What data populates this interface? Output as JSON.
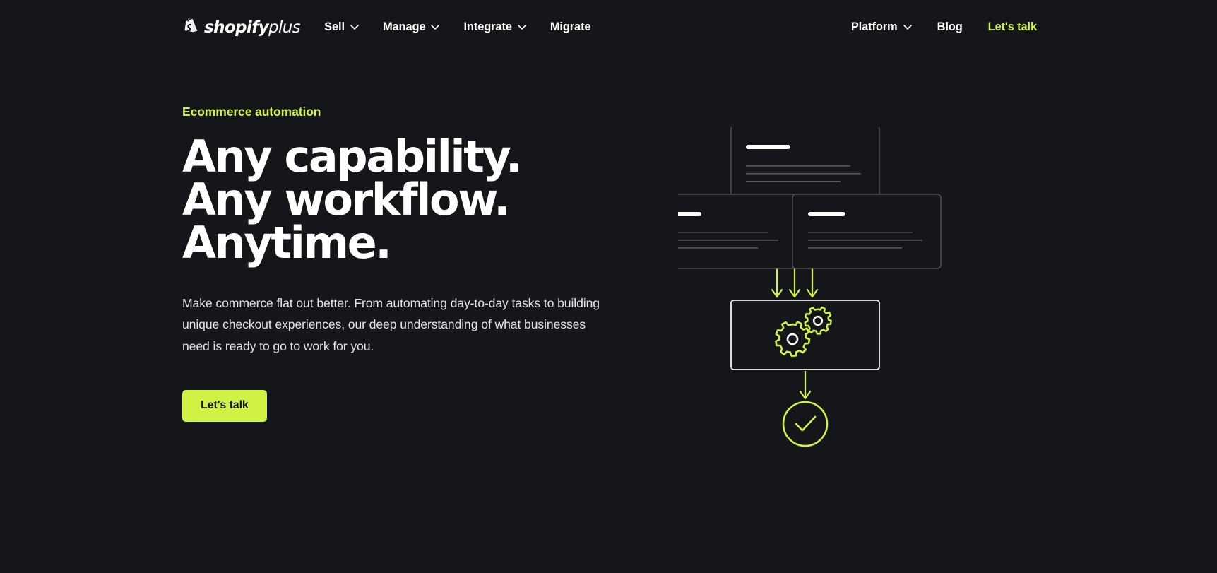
{
  "brand": {
    "accent_green": "#cff244",
    "background": "#15161a",
    "logo_shopify": "shopify",
    "logo_plus": "plus",
    "logo_icon": "shopify-bag-icon"
  },
  "nav": {
    "left_items": [
      {
        "label": "Sell",
        "has_caret": true
      },
      {
        "label": "Manage",
        "has_caret": true
      },
      {
        "label": "Integrate",
        "has_caret": true
      },
      {
        "label": "Migrate",
        "has_caret": false
      }
    ],
    "right_items": [
      {
        "label": "Platform",
        "has_caret": true
      },
      {
        "label": "Blog",
        "has_caret": false
      },
      {
        "label": "Let's talk",
        "has_caret": false,
        "accent": true
      }
    ]
  },
  "hero": {
    "eyebrow": "Ecommerce automation",
    "headline_lines": [
      "Any capability.",
      "Any workflow.",
      "Anytime."
    ],
    "body": "Make commerce flat out better. From automating day-to-day tasks to building unique checkout experiences, our deep understanding of what businesses need is ready to go to work for you.",
    "cta_label": "Let's talk"
  },
  "illustration": {
    "name": "automation-workflow-diagram",
    "cards": [
      {
        "name": "card-top",
        "title_bar": true,
        "text_lines": 3
      },
      {
        "name": "card-left",
        "title_bar": true,
        "text_lines": 3
      },
      {
        "name": "card-right",
        "title_bar": true,
        "text_lines": 3
      }
    ],
    "processor": {
      "name": "gears-box",
      "icon": "gears-icon"
    },
    "result": {
      "name": "success-circle",
      "icon": "checkmark-icon"
    },
    "arrow_count": 4
  }
}
